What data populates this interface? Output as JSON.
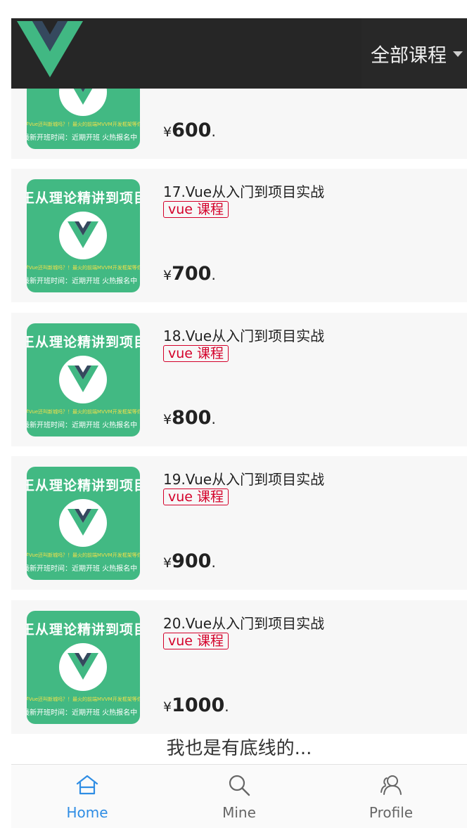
{
  "header": {
    "filter_label": "全部课程",
    "logo": "vue-logo"
  },
  "colors": {
    "header_bg": "#262626",
    "thumb_green": "#42b983",
    "tag_red": "#d4002a",
    "active_blue": "#2f8de4"
  },
  "thumb_text": {
    "line1": "王从理论精讲到项目",
    "line2": "学Vue还叫新城吗？！最火的前端MVVM开发框架等你来",
    "line3": "最新开班时间：近期开班 火热报名中"
  },
  "items": [
    {
      "title": "",
      "tag": "",
      "currency": "¥",
      "price": "600",
      "suffix": "."
    },
    {
      "title": "17.Vue从入门到项目实战",
      "tag": "vue 课程",
      "currency": "¥",
      "price": "700",
      "suffix": "."
    },
    {
      "title": "18.Vue从入门到项目实战",
      "tag": "vue 课程",
      "currency": "¥",
      "price": "800",
      "suffix": "."
    },
    {
      "title": "19.Vue从入门到项目实战",
      "tag": "vue 课程",
      "currency": "¥",
      "price": "900",
      "suffix": "."
    },
    {
      "title": "20.Vue从入门到项目实战",
      "tag": "vue 课程",
      "currency": "¥",
      "price": "1000",
      "suffix": "."
    }
  ],
  "end_text": "我也是有底线的...",
  "tabs": [
    {
      "label": "Home",
      "icon": "home-icon",
      "active": true
    },
    {
      "label": "Mine",
      "icon": "search-icon",
      "active": false
    },
    {
      "label": "Profile",
      "icon": "users-icon",
      "active": false
    }
  ]
}
